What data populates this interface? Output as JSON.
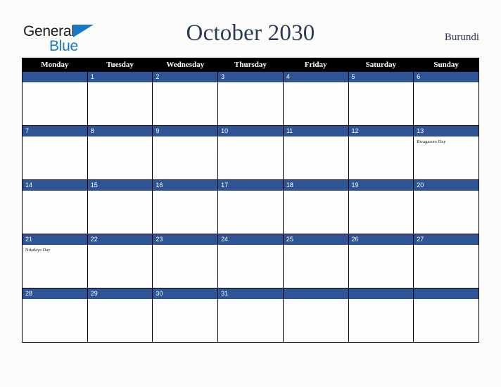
{
  "brand": {
    "name_top": "General",
    "name_bottom": "Blue",
    "triangle_icon": "blue-triangle-icon",
    "color_dark": "#1d1d1b",
    "color_blue": "#1878c8"
  },
  "header": {
    "title": "October 2030",
    "country": "Burundi",
    "title_color": "#2b3a59"
  },
  "colors": {
    "header_row_bg": "#000000",
    "header_row_text": "#ffffff",
    "date_band_bg": "#2e5496",
    "date_band_text": "#ffffff",
    "cell_bg": "#fdfdfd",
    "page_bg": "#fbfbfa",
    "grid_line": "#000000"
  },
  "weekdays": [
    "Monday",
    "Tuesday",
    "Wednesday",
    "Thursday",
    "Friday",
    "Saturday",
    "Sunday"
  ],
  "weeks": [
    [
      {
        "date": "",
        "events": []
      },
      {
        "date": "1",
        "events": []
      },
      {
        "date": "2",
        "events": []
      },
      {
        "date": "3",
        "events": []
      },
      {
        "date": "4",
        "events": []
      },
      {
        "date": "5",
        "events": []
      },
      {
        "date": "6",
        "events": []
      }
    ],
    [
      {
        "date": "7",
        "events": []
      },
      {
        "date": "8",
        "events": []
      },
      {
        "date": "9",
        "events": []
      },
      {
        "date": "10",
        "events": []
      },
      {
        "date": "11",
        "events": []
      },
      {
        "date": "12",
        "events": []
      },
      {
        "date": "13",
        "events": [
          "Rwagasore Day"
        ]
      }
    ],
    [
      {
        "date": "14",
        "events": []
      },
      {
        "date": "15",
        "events": []
      },
      {
        "date": "16",
        "events": []
      },
      {
        "date": "17",
        "events": []
      },
      {
        "date": "18",
        "events": []
      },
      {
        "date": "19",
        "events": []
      },
      {
        "date": "20",
        "events": []
      }
    ],
    [
      {
        "date": "21",
        "events": [
          "Ndadaye Day"
        ]
      },
      {
        "date": "22",
        "events": []
      },
      {
        "date": "23",
        "events": []
      },
      {
        "date": "24",
        "events": []
      },
      {
        "date": "25",
        "events": []
      },
      {
        "date": "26",
        "events": []
      },
      {
        "date": "27",
        "events": []
      }
    ],
    [
      {
        "date": "28",
        "events": []
      },
      {
        "date": "29",
        "events": []
      },
      {
        "date": "30",
        "events": []
      },
      {
        "date": "31",
        "events": []
      },
      {
        "date": "",
        "events": []
      },
      {
        "date": "",
        "events": []
      },
      {
        "date": "",
        "events": []
      }
    ]
  ]
}
